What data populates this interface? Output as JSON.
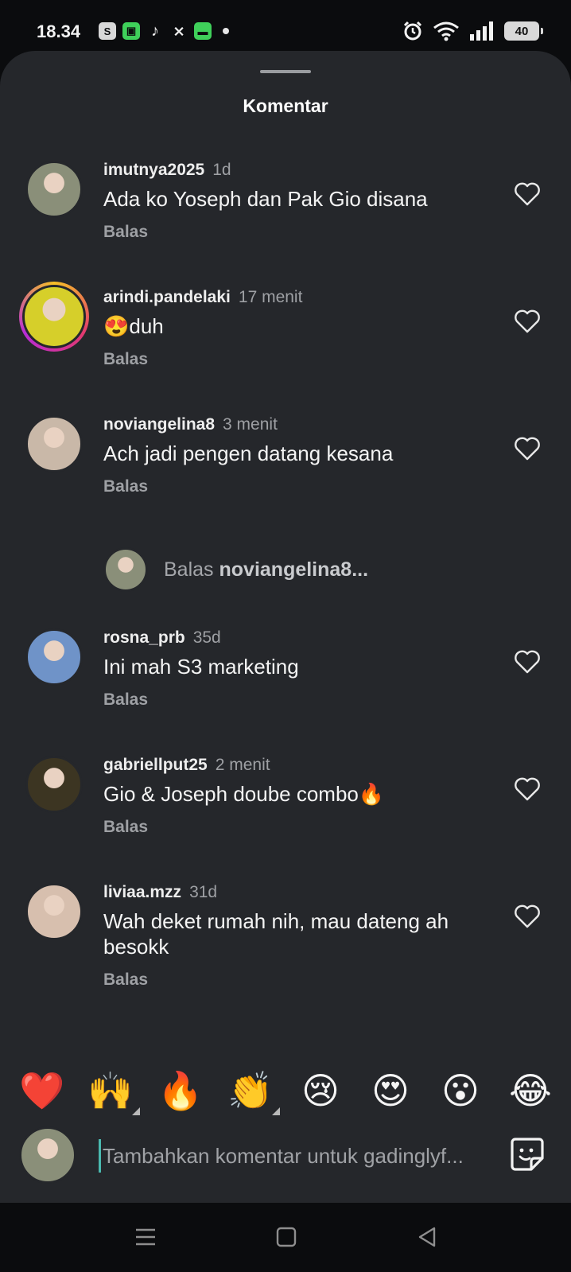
{
  "status_bar": {
    "time": "18.34",
    "battery": "40",
    "icons": [
      "shopee-notification-icon",
      "green-app-icon",
      "tiktok-icon",
      "capcut-icon",
      "chat-app-icon",
      "dot-icon",
      "alarm-icon",
      "wifi-icon",
      "signal-icon",
      "battery-icon"
    ]
  },
  "sheet": {
    "title": "Komentar"
  },
  "comments": [
    {
      "username": "imutnya2025",
      "time": "1d",
      "text": "Ada ko Yoseph dan Pak Gio disana",
      "reply": "Balas",
      "avatar_color": "#8a8f79"
    },
    {
      "username": "arindi.pandelaki",
      "time": "17 menit",
      "text": "😍duh",
      "reply": "Balas",
      "avatar_color": "#d6cf2a"
    },
    {
      "username": "noviangelina8",
      "time": "3 menit",
      "text": "Ach jadi pengen datang kesana",
      "reply": "Balas",
      "avatar_color": "#c9b8a8"
    },
    {
      "username": "rosna_prb",
      "time": "35d",
      "text": "Ini mah S3 marketing",
      "reply": "Balas",
      "avatar_color": "#6f93c8"
    },
    {
      "username": "gabriellput25",
      "time": "2 menit",
      "text": "Gio & Joseph doube combo🔥",
      "reply": "Balas",
      "avatar_color": "#3c3522"
    },
    {
      "username": "liviaa.mzz",
      "time": "31d",
      "text": "Wah deket rumah nih, mau dateng ah besokk",
      "reply": "Balas",
      "avatar_color": "#d7bfae"
    }
  ],
  "reply_prompt": {
    "prefix": "Balas",
    "target": "noviangelina8..."
  },
  "emoji_bar": [
    "❤️",
    "🙌",
    "🔥",
    "👏",
    "😢",
    "😍",
    "😮",
    "😂"
  ],
  "composer": {
    "placeholder": "Tambahkan komentar untuk gadinglyf..."
  },
  "colors": {
    "sheet_bg": "#25272b",
    "accent_cursor": "#4ab9b0",
    "muted_text": "#9ea0a4"
  }
}
